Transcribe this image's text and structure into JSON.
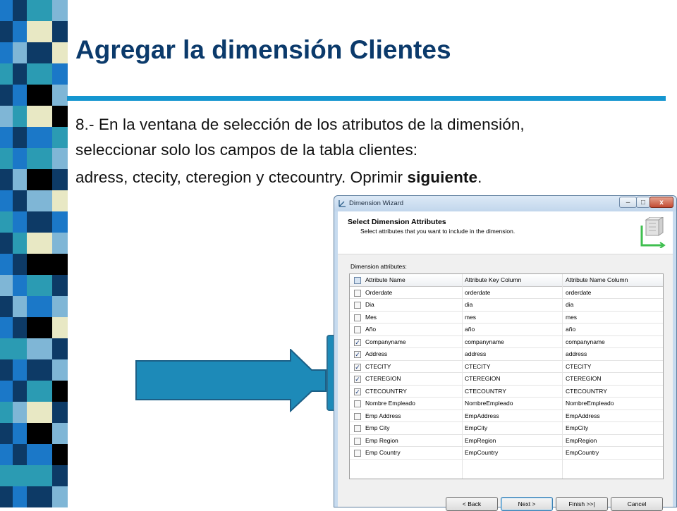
{
  "colors": {
    "title": "#0b3a6b",
    "rule": "#1596d0",
    "arrow": "#1d8ab8",
    "strip_navy": "#0d3a66",
    "strip_blue": "#1b78c8",
    "strip_teal": "#2b9bb3",
    "strip_cream": "#e8e8c4",
    "strip_black": "#000000",
    "strip_light": "#7fb6d6"
  },
  "slide": {
    "title": "Agregar la dimensión Clientes",
    "line1": "8.- En la ventana de selección de los atributos de la dimensión,",
    "line2": "seleccionar solo los campos de la tabla clientes:",
    "line3_pre": "adress, ctecity, cteregion y ctecountry. Oprimir ",
    "line3_bold": "siguiente",
    "line3_post": "."
  },
  "window": {
    "title": "Dimension Wizard",
    "header_title": "Select Dimension Attributes",
    "header_subtitle": "Select attributes that you want to include in the dimension.",
    "list_label": "Dimension attributes:",
    "columns": [
      "Attribute Name",
      "Attribute Key Column",
      "Attribute Name Column"
    ],
    "rows": [
      {
        "name": "Orderdate",
        "key": "orderdate",
        "namecol": "orderdate",
        "checked": false
      },
      {
        "name": "Dia",
        "key": "dia",
        "namecol": "dia",
        "checked": false
      },
      {
        "name": "Mes",
        "key": "mes",
        "namecol": "mes",
        "checked": false
      },
      {
        "name": "Año",
        "key": "año",
        "namecol": "año",
        "checked": false
      },
      {
        "name": "Companyname",
        "key": "companyname",
        "namecol": "companyname",
        "checked": true
      },
      {
        "name": "Address",
        "key": "address",
        "namecol": "address",
        "checked": true
      },
      {
        "name": "CTECITY",
        "key": "CTECITY",
        "namecol": "CTECITY",
        "checked": true
      },
      {
        "name": "CTEREGION",
        "key": "CTEREGION",
        "namecol": "CTEREGION",
        "checked": true
      },
      {
        "name": "CTECOUNTRY",
        "key": "CTECOUNTRY",
        "namecol": "CTECOUNTRY",
        "checked": true
      },
      {
        "name": "Nombre Empleado",
        "key": "NombreEmpleado",
        "namecol": "NombreEmpleado",
        "checked": false
      },
      {
        "name": "Emp Address",
        "key": "EmpAddress",
        "namecol": "EmpAddress",
        "checked": false
      },
      {
        "name": "Emp City",
        "key": "EmpCity",
        "namecol": "EmpCity",
        "checked": false
      },
      {
        "name": "Emp Region",
        "key": "EmpRegion",
        "namecol": "EmpRegion",
        "checked": false
      },
      {
        "name": "Emp Country",
        "key": "EmpCountry",
        "namecol": "EmpCountry",
        "checked": false
      }
    ],
    "buttons": {
      "back": "< Back",
      "next": "Next >",
      "finish": "Finish >>|",
      "cancel": "Cancel"
    },
    "controls": {
      "minimize": "‒",
      "restore": "□",
      "close": "x"
    }
  }
}
